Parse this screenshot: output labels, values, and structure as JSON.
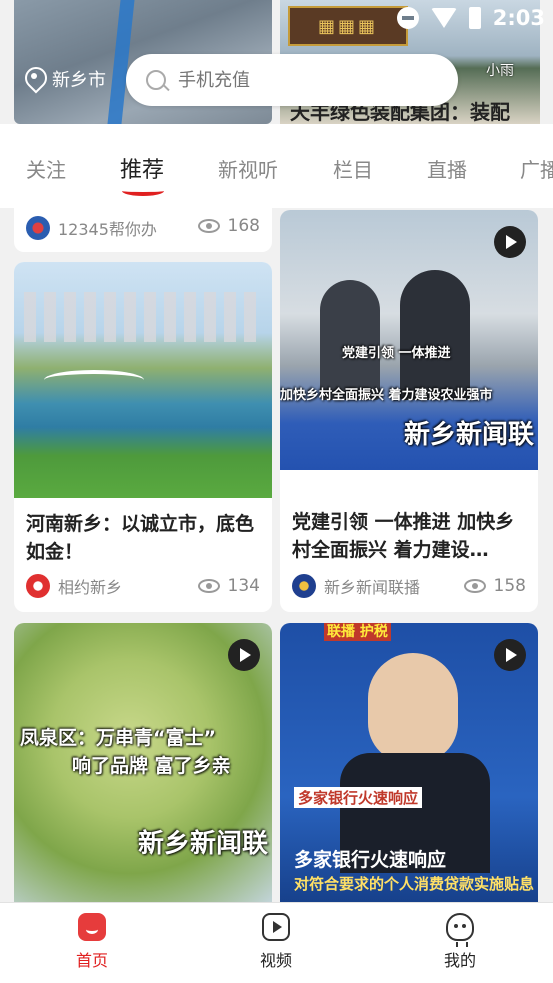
{
  "status_bar": {
    "time": "2:03"
  },
  "header": {
    "location": "新乡市",
    "search_placeholder": "手机充值",
    "banner_headline": "天丰绿色装配集团：装配",
    "banner_weather": "小雨"
  },
  "tabs": [
    {
      "label": "关注"
    },
    {
      "label": "推荐",
      "active": true
    },
    {
      "label": "新视听"
    },
    {
      "label": "栏目"
    },
    {
      "label": "直播"
    },
    {
      "label": "广播"
    }
  ],
  "feed": {
    "top_partial": {
      "source": "12345帮你办",
      "views": "168"
    },
    "cards": [
      {
        "title": "河南新乡：以诚立市，底色如金！",
        "source": "相约新乡",
        "views": "134"
      },
      {
        "title": "党建引领 一体推进 加快乡村全面振兴 着力建设…",
        "source": "新乡新闻联播",
        "views": "158",
        "overlay_line1": "党建引领 一体推进",
        "overlay_line2": "加快乡村全面振兴 着力建设农业强市",
        "overlay_brand": "新乡新闻联"
      },
      {
        "overlay_line1": "凤泉区：万串青“富士”",
        "overlay_line2": "响了品牌 富了乡亲",
        "overlay_brand": "新乡新闻联"
      },
      {
        "overlay_tag": "联播 护税",
        "overlay_line1": "多家银行火速响应",
        "overlay_line2": "多家银行火速响应",
        "overlay_line3": "对符合要求的个人消费贷款实施贴息"
      }
    ]
  },
  "bottom_nav": [
    {
      "label": "首页",
      "active": true
    },
    {
      "label": "视频"
    },
    {
      "label": "我的"
    }
  ],
  "colors": {
    "accent": "#e02020"
  }
}
